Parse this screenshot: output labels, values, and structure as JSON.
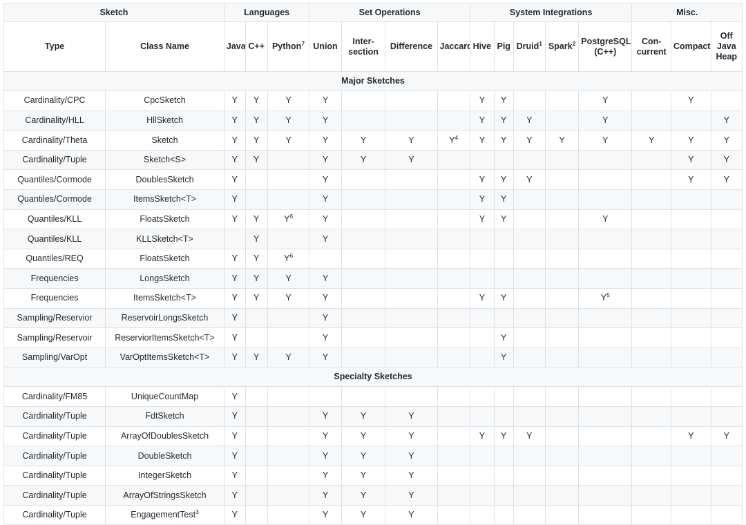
{
  "table": {
    "groups": [
      {
        "label": "Sketch",
        "span": 2
      },
      {
        "label": "Languages",
        "span": 3
      },
      {
        "label": "Set Operations",
        "span": 4
      },
      {
        "label": "System Integrations",
        "span": 5
      },
      {
        "label": "Misc.",
        "span": 3
      }
    ],
    "columns": [
      {
        "label": "Type",
        "sup": ""
      },
      {
        "label": "Class Name",
        "sup": ""
      },
      {
        "label": "Java",
        "sup": ""
      },
      {
        "label": "C++",
        "sup": ""
      },
      {
        "label": "Python",
        "sup": "7"
      },
      {
        "label": "Union",
        "sup": ""
      },
      {
        "label": "Inter-section",
        "sup": ""
      },
      {
        "label": "Difference",
        "sup": ""
      },
      {
        "label": "Jaccard",
        "sup": ""
      },
      {
        "label": "Hive",
        "sup": ""
      },
      {
        "label": "Pig",
        "sup": ""
      },
      {
        "label": "Druid",
        "sup": "1"
      },
      {
        "label": "Spark",
        "sup": "2"
      },
      {
        "label": "PostgreSQL (C++)",
        "sup": ""
      },
      {
        "label": "Con-current",
        "sup": ""
      },
      {
        "label": "Compact",
        "sup": ""
      },
      {
        "label": "Off Java Heap",
        "sup": ""
      }
    ],
    "sections": [
      {
        "title": "Major Sketches",
        "rows": [
          {
            "type": "Cardinality/CPC",
            "class": "CpcSketch",
            "class_sup": "",
            "marks": [
              "Y",
              "Y",
              "Y",
              "Y",
              "",
              "",
              "",
              "Y",
              "Y",
              "",
              "",
              "Y",
              "",
              "Y",
              ""
            ]
          },
          {
            "type": "Cardinality/HLL",
            "class": "HllSketch",
            "class_sup": "",
            "marks": [
              "Y",
              "Y",
              "Y",
              "Y",
              "",
              "",
              "",
              "Y",
              "Y",
              "Y",
              "",
              "Y",
              "",
              "",
              "Y"
            ]
          },
          {
            "type": "Cardinality/Theta",
            "class": "Sketch",
            "class_sup": "",
            "marks": [
              "Y",
              "Y",
              "Y",
              "Y",
              "Y",
              "Y",
              "Y4",
              "Y",
              "Y",
              "Y",
              "Y",
              "Y",
              "Y",
              "Y",
              "Y"
            ]
          },
          {
            "type": "Cardinality/Tuple",
            "class": "Sketch<S>",
            "class_sup": "",
            "marks": [
              "Y",
              "Y",
              "",
              "Y",
              "Y",
              "Y",
              "",
              "",
              "",
              "",
              "",
              "",
              "",
              "Y",
              "Y"
            ]
          },
          {
            "type": "Quantiles/Cormode",
            "class": "DoublesSketch",
            "class_sup": "",
            "marks": [
              "Y",
              "",
              "",
              "Y",
              "",
              "",
              "",
              "Y",
              "Y",
              "Y",
              "",
              "",
              "",
              "Y",
              "Y"
            ]
          },
          {
            "type": "Quantiles/Cormode",
            "class": "ItemsSketch<T>",
            "class_sup": "",
            "marks": [
              "Y",
              "",
              "",
              "Y",
              "",
              "",
              "",
              "Y",
              "Y",
              "",
              "",
              "",
              "",
              "",
              ""
            ]
          },
          {
            "type": "Quantiles/KLL",
            "class": "FloatsSketch",
            "class_sup": "",
            "marks": [
              "Y",
              "Y",
              "Y6",
              "Y",
              "",
              "",
              "",
              "Y",
              "Y",
              "",
              "",
              "Y",
              "",
              "",
              ""
            ]
          },
          {
            "type": "Quantiles/KLL",
            "class": "KLLSketch<T>",
            "class_sup": "",
            "marks": [
              "",
              "Y",
              "",
              "Y",
              "",
              "",
              "",
              "",
              "",
              "",
              "",
              "",
              "",
              "",
              ""
            ]
          },
          {
            "type": "Quantiles/REQ",
            "class": "FloatsSketch",
            "class_sup": "",
            "marks": [
              "Y",
              "Y",
              "Y6",
              "",
              "",
              "",
              "",
              "",
              "",
              "",
              "",
              "",
              "",
              "",
              ""
            ]
          },
          {
            "type": "Frequencies",
            "class": "LongsSketch",
            "class_sup": "",
            "marks": [
              "Y",
              "Y",
              "Y",
              "Y",
              "",
              "",
              "",
              "",
              "",
              "",
              "",
              "",
              "",
              "",
              ""
            ]
          },
          {
            "type": "Frequencies",
            "class": "ItemsSketch<T>",
            "class_sup": "",
            "marks": [
              "Y",
              "Y",
              "Y",
              "Y",
              "",
              "",
              "",
              "Y",
              "Y",
              "",
              "",
              "Y5",
              "",
              "",
              ""
            ]
          },
          {
            "type": "Sampling/Reservior",
            "class": "ReservoirLongsSketch",
            "class_sup": "",
            "marks": [
              "Y",
              "",
              "",
              "Y",
              "",
              "",
              "",
              "",
              "",
              "",
              "",
              "",
              "",
              "",
              ""
            ]
          },
          {
            "type": "Sampling/Reservoir",
            "class": "ReserviorItemsSketch<T>",
            "class_sup": "",
            "marks": [
              "Y",
              "",
              "",
              "Y",
              "",
              "",
              "",
              "",
              "Y",
              "",
              "",
              "",
              "",
              "",
              ""
            ]
          },
          {
            "type": "Sampling/VarOpt",
            "class": "VarOptItemsSketch<T>",
            "class_sup": "",
            "marks": [
              "Y",
              "Y",
              "Y",
              "Y",
              "",
              "",
              "",
              "",
              "Y",
              "",
              "",
              "",
              "",
              "",
              ""
            ]
          }
        ]
      },
      {
        "title": "Specialty Sketches",
        "rows": [
          {
            "type": "Cardinality/FM85",
            "class": "UniqueCountMap",
            "class_sup": "",
            "marks": [
              "Y",
              "",
              "",
              "",
              "",
              "",
              "",
              "",
              "",
              "",
              "",
              "",
              "",
              "",
              ""
            ]
          },
          {
            "type": "Cardinality/Tuple",
            "class": "FdtSketch",
            "class_sup": "",
            "marks": [
              "Y",
              "",
              "",
              "Y",
              "Y",
              "Y",
              "",
              "",
              "",
              "",
              "",
              "",
              "",
              "",
              ""
            ]
          },
          {
            "type": "Cardinality/Tuple",
            "class": "ArrayOfDoublesSketch",
            "class_sup": "",
            "marks": [
              "Y",
              "",
              "",
              "Y",
              "Y",
              "Y",
              "",
              "Y",
              "Y",
              "Y",
              "",
              "",
              "",
              "Y",
              "Y"
            ]
          },
          {
            "type": "Cardinality/Tuple",
            "class": "DoubleSketch",
            "class_sup": "",
            "marks": [
              "Y",
              "",
              "",
              "Y",
              "Y",
              "Y",
              "",
              "",
              "",
              "",
              "",
              "",
              "",
              "",
              ""
            ]
          },
          {
            "type": "Cardinality/Tuple",
            "class": "IntegerSketch",
            "class_sup": "",
            "marks": [
              "Y",
              "",
              "",
              "Y",
              "Y",
              "Y",
              "",
              "",
              "",
              "",
              "",
              "",
              "",
              "",
              ""
            ]
          },
          {
            "type": "Cardinality/Tuple",
            "class": "ArrayOfStringsSketch",
            "class_sup": "",
            "marks": [
              "Y",
              "",
              "",
              "Y",
              "Y",
              "Y",
              "",
              "",
              "",
              "",
              "",
              "",
              "",
              "",
              ""
            ]
          },
          {
            "type": "Cardinality/Tuple",
            "class": "EngagementTest",
            "class_sup": "3",
            "marks": [
              "Y",
              "",
              "",
              "Y",
              "Y",
              "Y",
              "",
              "",
              "",
              "",
              "",
              "",
              "",
              "",
              ""
            ]
          }
        ]
      }
    ]
  }
}
